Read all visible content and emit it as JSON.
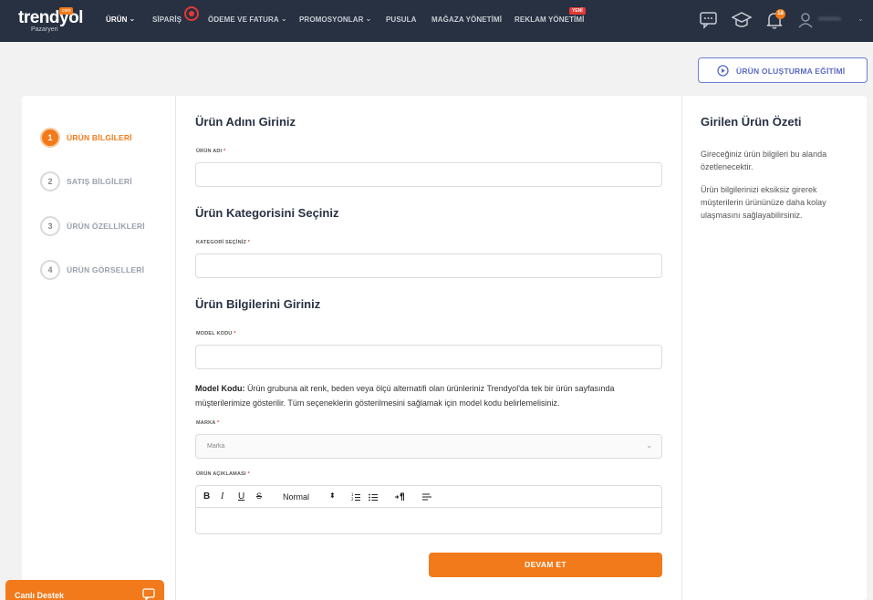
{
  "brand": {
    "logo_text": "trendyol",
    "logo_badge": "com",
    "logo_sub": "Pazaryeri",
    "accent": "#f27a1a",
    "nav_bg": "#273142"
  },
  "nav": {
    "items": [
      {
        "label": "ÜRÜN",
        "dropdown": true,
        "active": true
      },
      {
        "label": "SİPARİŞ",
        "dropdown": false
      },
      {
        "label": "ÖDEME VE FATURA",
        "dropdown": true
      },
      {
        "label": "PROMOSYONLAR",
        "dropdown": true
      },
      {
        "label": "PUSULA",
        "dropdown": false
      },
      {
        "label": "MAĞAZA YÖNETİMİ",
        "dropdown": false
      },
      {
        "label": "REKLAM YÖNETİMİ",
        "dropdown": false
      }
    ],
    "new_badge": "YENİ",
    "notification_count": "18",
    "icons": [
      "chat-icon",
      "graduation-cap-icon",
      "bell-icon",
      "user-icon"
    ]
  },
  "training_button": {
    "label": "ÜRÜN OLUŞTURMA EĞİTİMİ",
    "icon": "play-circle-icon"
  },
  "steps": [
    {
      "num": "1",
      "label": "ÜRÜN BİLGİLERİ",
      "active": true
    },
    {
      "num": "2",
      "label": "SATIŞ BİLGİLERİ",
      "active": false
    },
    {
      "num": "3",
      "label": "ÜRÜN ÖZELLİKLERİ",
      "active": false
    },
    {
      "num": "4",
      "label": "ÜRÜN GÖRSELLERİ",
      "active": false
    }
  ],
  "form": {
    "section_name": "Ürün Adını Giriniz",
    "name_label": "ÜRÜN ADI",
    "section_category": "Ürün Kategorisini Seçiniz",
    "category_label": "KATEGORİ SEÇİNİZ",
    "section_info": "Ürün Bilgilerini Giriniz",
    "model_label": "MODEL KODU",
    "model_help_title": "Model Kodu:",
    "model_help_text": "Ürün grubuna ait renk, beden veya ölçü alternatifi olan ürünleriniz Trendyol'da tek bir ürün sayfasında müşterilerimize gösterilir. Tüm seçeneklerin gösterilmesini sağlamak için model kodu belirlemelisiniz.",
    "brand_label": "MARKA",
    "brand_placeholder": "Marka",
    "description_label": "ÜRÜN AÇIKLAMASI",
    "required_mark": "*",
    "editor": {
      "bold": "B",
      "italic": "I",
      "underline": "U",
      "strike": "S",
      "header": "Normal",
      "header_arrows": "⬍"
    },
    "submit_label": "DEVAM ET"
  },
  "summary": {
    "title": "Girilen Ürün Özeti",
    "text1": "Gireceğiniz ürün bilgileri bu alanda özetlenecektir.",
    "text2": "Ürün bilgilerinizi eksiksiz girerek müşterilerin ürününüze daha kolay ulaşmasını sağlayabilirsiniz."
  },
  "live_support": {
    "label": "Canlı Destek",
    "icon": "message-icon"
  }
}
